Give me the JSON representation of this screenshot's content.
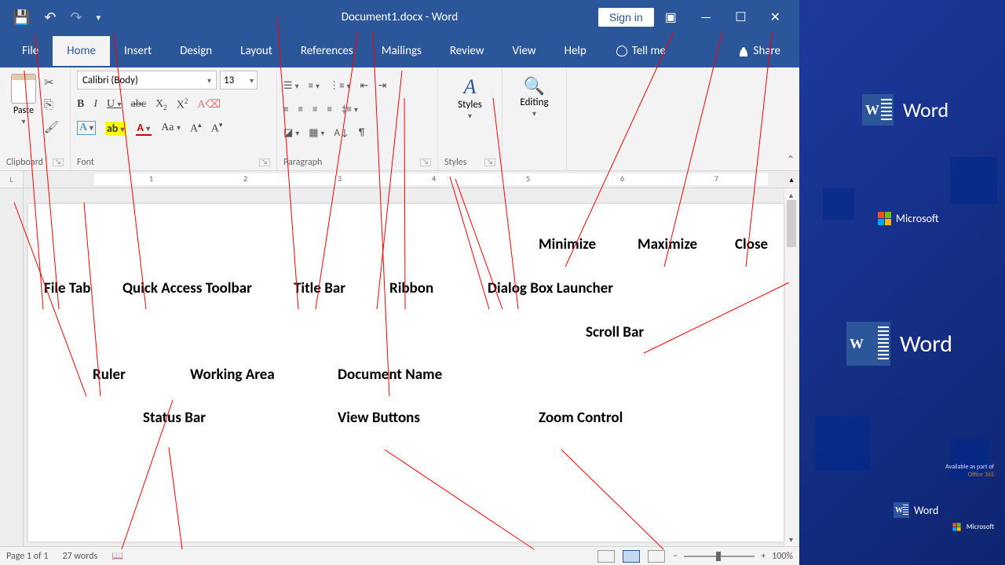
{
  "title_bar": {
    "document_title": "Document1.docx - Word",
    "signin": "Sign in"
  },
  "tabs": {
    "file": "File",
    "home": "Home",
    "insert": "Insert",
    "design": "Design",
    "layout": "Layout",
    "references": "References",
    "mailings": "Mailings",
    "review": "Review",
    "view": "View",
    "help": "Help",
    "tellme": "Tell me",
    "share": "Share"
  },
  "ribbon": {
    "clipboard": {
      "paste": "Paste",
      "label": "Clipboard"
    },
    "font": {
      "name": "Calibri (Body)",
      "size": "13",
      "label": "Font",
      "aa": "Aa"
    },
    "paragraph": {
      "label": "Paragraph"
    },
    "styles": {
      "big": "Styles",
      "label": "Styles"
    },
    "editing": {
      "big": "Editing",
      "label": ""
    }
  },
  "annotations": {
    "file_tab": "File Tab",
    "qat": "Quick Access Toolbar",
    "title_bar": "Title Bar",
    "ribbon": "Ribbon",
    "dialog": "Dialog Box Launcher",
    "minimize": "Minimize",
    "maximize": "Maximize",
    "close": "Close",
    "ruler": "Ruler",
    "working": "Working Area",
    "docname": "Document Name",
    "scrollbar": "Scroll Bar",
    "status": "Status Bar",
    "viewbtn": "View Buttons",
    "zoom": "Zoom Control"
  },
  "status": {
    "page": "Page 1 of 1",
    "words": "27 words",
    "zoom": "100%"
  },
  "sidebar": {
    "word": "Word",
    "microsoft": "Microsoft",
    "footer1": "Available as part of",
    "footer2": "Office 365"
  },
  "ruler_nums": [
    "1",
    "2",
    "3",
    "4",
    "5",
    "6",
    "7"
  ]
}
